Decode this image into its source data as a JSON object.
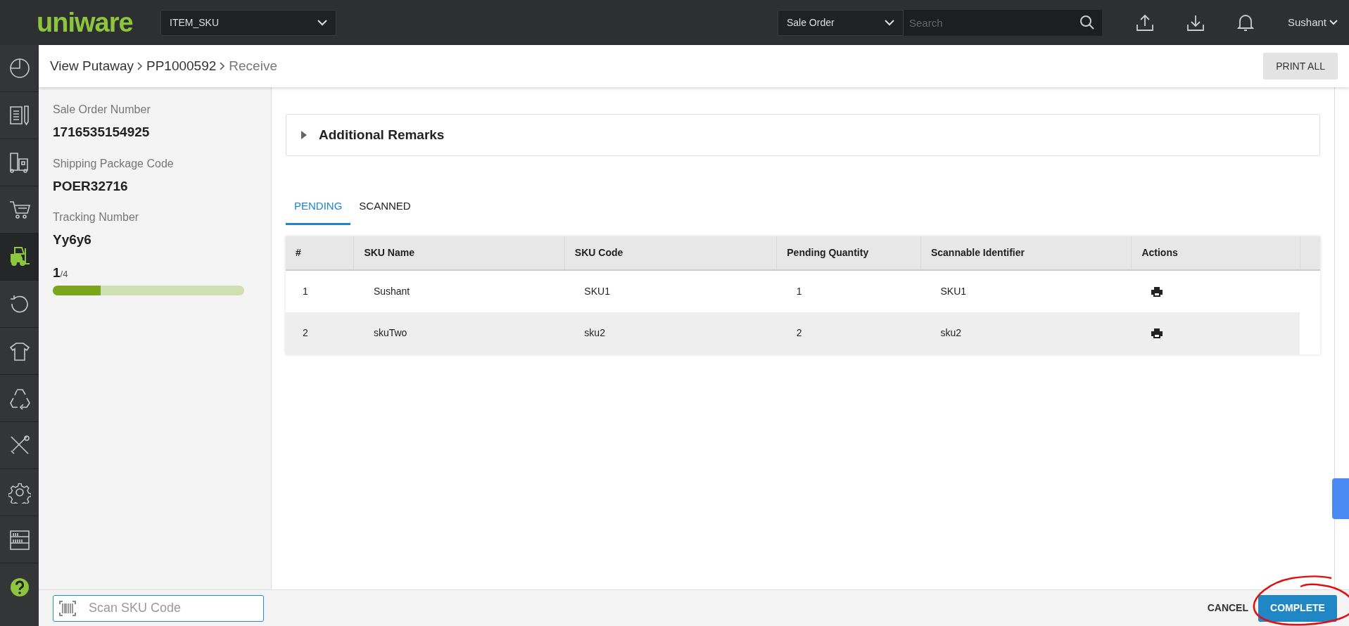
{
  "topbar": {
    "logo": "uniware",
    "module_select": {
      "value": "ITEM_SKU"
    },
    "search_scope": {
      "value": "Sale Order"
    },
    "search": {
      "placeholder": "Search"
    },
    "user": "Sushant"
  },
  "sidebar": {
    "items": [
      {
        "kind": "dashboard",
        "selected": false
      },
      {
        "kind": "document",
        "selected": false
      },
      {
        "kind": "truck",
        "selected": false
      },
      {
        "kind": "cart",
        "selected": false
      },
      {
        "kind": "forklift",
        "selected": true
      },
      {
        "kind": "refresh",
        "selected": false
      },
      {
        "kind": "shirt",
        "selected": false
      },
      {
        "kind": "recycle",
        "selected": false
      },
      {
        "kind": "tools",
        "selected": false
      },
      {
        "kind": "gear",
        "selected": false
      },
      {
        "kind": "shelf",
        "selected": false
      },
      {
        "kind": "help",
        "selected": false
      }
    ]
  },
  "breadcrumb": [
    {
      "label": "View Putaway",
      "current": false
    },
    {
      "label": "PP1000592",
      "current": false
    },
    {
      "label": "Receive",
      "current": true
    }
  ],
  "print_all_button": "PRINT ALL",
  "details": [
    {
      "label": "Sale Order Number",
      "value": "1716535154925"
    },
    {
      "label": "Shipping Package Code",
      "value": "POER32716"
    },
    {
      "label": "Tracking Number",
      "value": "Yy6y6"
    }
  ],
  "progress": {
    "done": "1",
    "total": "/4",
    "level": 0.25
  },
  "remarks": {
    "title": "Additional Remarks",
    "expanded": false
  },
  "tabs": [
    {
      "label": "PENDING",
      "selected": true
    },
    {
      "label": "SCANNED",
      "selected": false
    }
  ],
  "table": {
    "columns": [
      "#",
      "SKU Name",
      "SKU Code",
      "Pending Quantity",
      "Scannable Identifier",
      "Actions"
    ],
    "rows": [
      {
        "cells": [
          "1",
          "Sushant",
          "SKU1",
          "1",
          "SKU1"
        ]
      },
      {
        "cells": [
          "2",
          "skuTwo",
          "sku2",
          "2",
          "sku2"
        ]
      }
    ]
  },
  "footer": {
    "scan": {
      "placeholder": "Scan SKU Code"
    },
    "cancel": "CANCEL",
    "complete": "COMPLETE"
  }
}
